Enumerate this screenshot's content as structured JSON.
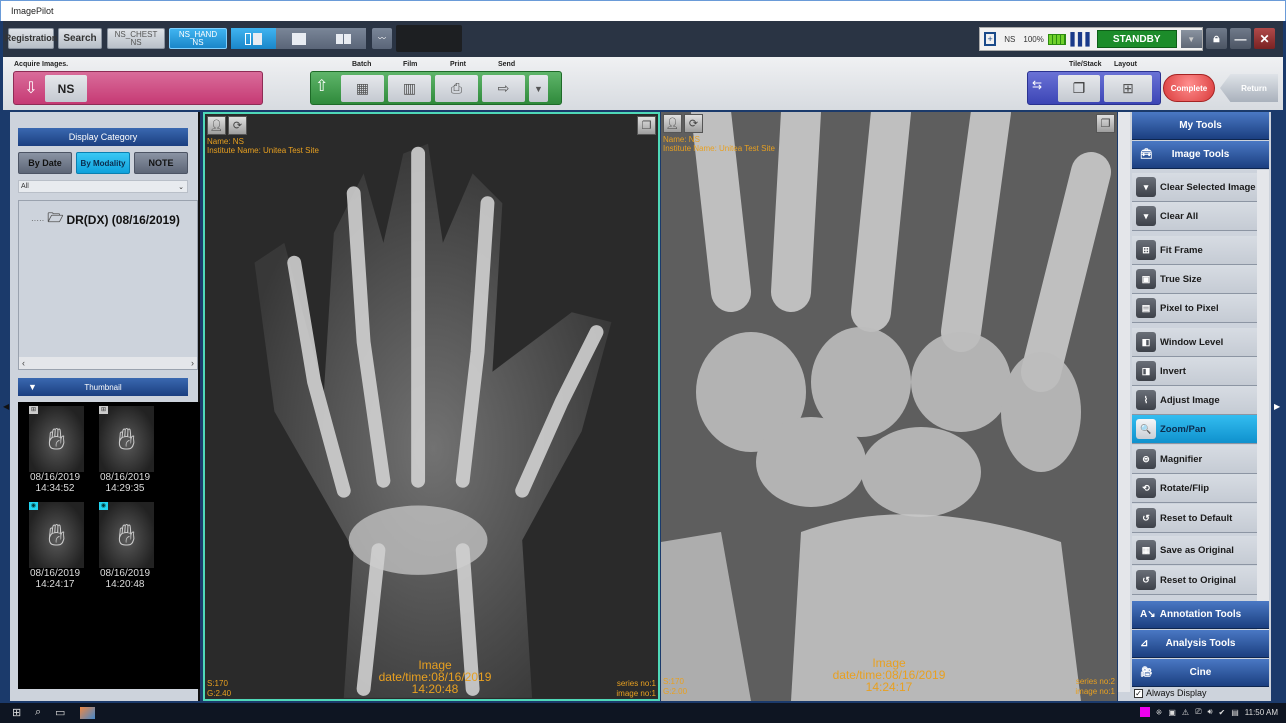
{
  "window": {
    "title": "ImagePilot"
  },
  "topbar": {
    "registration": "Registration",
    "search": "Search",
    "patient_tabs": [
      {
        "line1": "NS_CHEST",
        "line2": "NS",
        "active": false
      },
      {
        "line1": "NS_HAND",
        "line2": "NS",
        "active": true
      }
    ],
    "status": {
      "device": "NS",
      "battery": "100%",
      "state": "STANDBY",
      "state_color": "#1c8c2a"
    }
  },
  "toolbar": {
    "acquire_label": "Acquire Images.",
    "acquire_device": "NS",
    "output_labels": [
      "Batch",
      "Film",
      "Print",
      "Send"
    ],
    "tile_stack_label": "Tile/Stack",
    "layout_label": "Layout",
    "complete": "Complete",
    "return": "Return"
  },
  "left": {
    "display_category": "Display Category",
    "category_buttons": [
      {
        "label": "By Date",
        "active": false
      },
      {
        "label": "By Modality",
        "active": true
      },
      {
        "label": "NOTE",
        "active": false
      }
    ],
    "filter_value": "All",
    "tree_item": "DR(DX) (08/16/2019)",
    "thumbnail_header": "Thumbnail",
    "thumbnails": [
      {
        "date": "08/16/2019",
        "time": "14:34:52",
        "badge": "stack"
      },
      {
        "date": "08/16/2019",
        "time": "14:29:35",
        "badge": "stack"
      },
      {
        "date": "08/16/2019",
        "time": "14:24:17",
        "badge": "eye"
      },
      {
        "date": "08/16/2019",
        "time": "14:20:48",
        "badge": "eye"
      }
    ]
  },
  "viewers": [
    {
      "name": "Name: NS",
      "institute": "Institute Name: Unitea Test Site",
      "s": "S:170",
      "g": "G:2.40",
      "date_line1": "Image",
      "date_line2": "date/time:08/16/2019",
      "date_line3": "14:20:48",
      "series": "series no:1",
      "image": "image no:1",
      "selected": true
    },
    {
      "name": "Name: NS",
      "institute": "Institute Name: Unitea Test Site",
      "s": "S:170",
      "g": "G:2.00",
      "date_line1": "Image",
      "date_line2": "date/time:08/16/2019",
      "date_line3": "14:24:17",
      "series": "series no:2",
      "image": "image no:1",
      "selected": false
    }
  ],
  "right": {
    "my_tools": "My Tools",
    "image_tools": "Image Tools",
    "tools": [
      {
        "label": "Clear Selected Image",
        "icon": "clear-selected-icon",
        "glyph": "▾"
      },
      {
        "label": "Clear All",
        "icon": "clear-all-icon",
        "glyph": "▾"
      },
      {
        "label": "Fit Frame",
        "icon": "fit-frame-icon",
        "glyph": "⊞"
      },
      {
        "label": "True Size",
        "icon": "true-size-icon",
        "glyph": "▣"
      },
      {
        "label": "Pixel to Pixel",
        "icon": "pixel-to-pixel-icon",
        "glyph": "▤"
      },
      {
        "label": "Window Level",
        "icon": "window-level-icon",
        "glyph": "◧"
      },
      {
        "label": "Invert",
        "icon": "invert-icon",
        "glyph": "◨"
      },
      {
        "label": "Adjust Image",
        "icon": "adjust-image-icon",
        "glyph": "⌇"
      },
      {
        "label": "Zoom/Pan",
        "icon": "zoom-pan-icon",
        "glyph": "🔍",
        "selected": true
      },
      {
        "label": "Magnifier",
        "icon": "magnifier-icon",
        "glyph": "⊜"
      },
      {
        "label": "Rotate/Flip",
        "icon": "rotate-flip-icon",
        "glyph": "⟲"
      },
      {
        "label": "Reset to Default",
        "icon": "reset-default-icon",
        "glyph": "↺"
      },
      {
        "label": "Save as Original",
        "icon": "save-original-icon",
        "glyph": "▦"
      },
      {
        "label": "Reset to Original",
        "icon": "reset-original-icon",
        "glyph": "↺"
      }
    ],
    "annotation_tools": "Annotation Tools",
    "analysis_tools": "Analysis Tools",
    "cine": "Cine",
    "always_display": "Always Display"
  },
  "taskbar": {
    "clock": "11:50 AM"
  }
}
